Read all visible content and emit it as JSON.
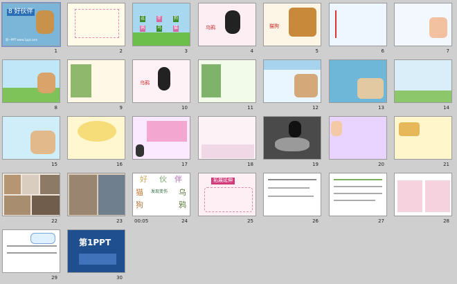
{
  "slides": [
    {
      "n": "1",
      "title": "8 好伙伴",
      "footer": "第一PPT www.1ppt.com"
    },
    {
      "n": "2"
    },
    {
      "n": "3",
      "words": [
        "逗",
        "伴",
        "狗",
        "鸦",
        "乌",
        "猫"
      ]
    },
    {
      "n": "4",
      "label": "乌鸦"
    },
    {
      "n": "5",
      "label": "猫狗"
    },
    {
      "n": "6"
    },
    {
      "n": "7"
    },
    {
      "n": "8"
    },
    {
      "n": "9"
    },
    {
      "n": "10",
      "label": "乌鸦"
    },
    {
      "n": "11"
    },
    {
      "n": "12"
    },
    {
      "n": "13"
    },
    {
      "n": "14"
    },
    {
      "n": "15"
    },
    {
      "n": "16"
    },
    {
      "n": "17"
    },
    {
      "n": "18"
    },
    {
      "n": "19"
    },
    {
      "n": "20"
    },
    {
      "n": "21"
    },
    {
      "n": "22"
    },
    {
      "n": "23"
    },
    {
      "n": "24",
      "time": "00:05",
      "words": [
        "好",
        "伙",
        "伴",
        "猫",
        "狗",
        "乌",
        "鸦",
        "发现变伤"
      ]
    },
    {
      "n": "25",
      "title": "拓展延伸"
    },
    {
      "n": "26"
    },
    {
      "n": "27"
    },
    {
      "n": "28"
    },
    {
      "n": "29"
    },
    {
      "n": "30",
      "logo": "第1PPT"
    }
  ],
  "colors": {
    "accent": "#6a8fd8",
    "bg": "#cfcfcf"
  }
}
